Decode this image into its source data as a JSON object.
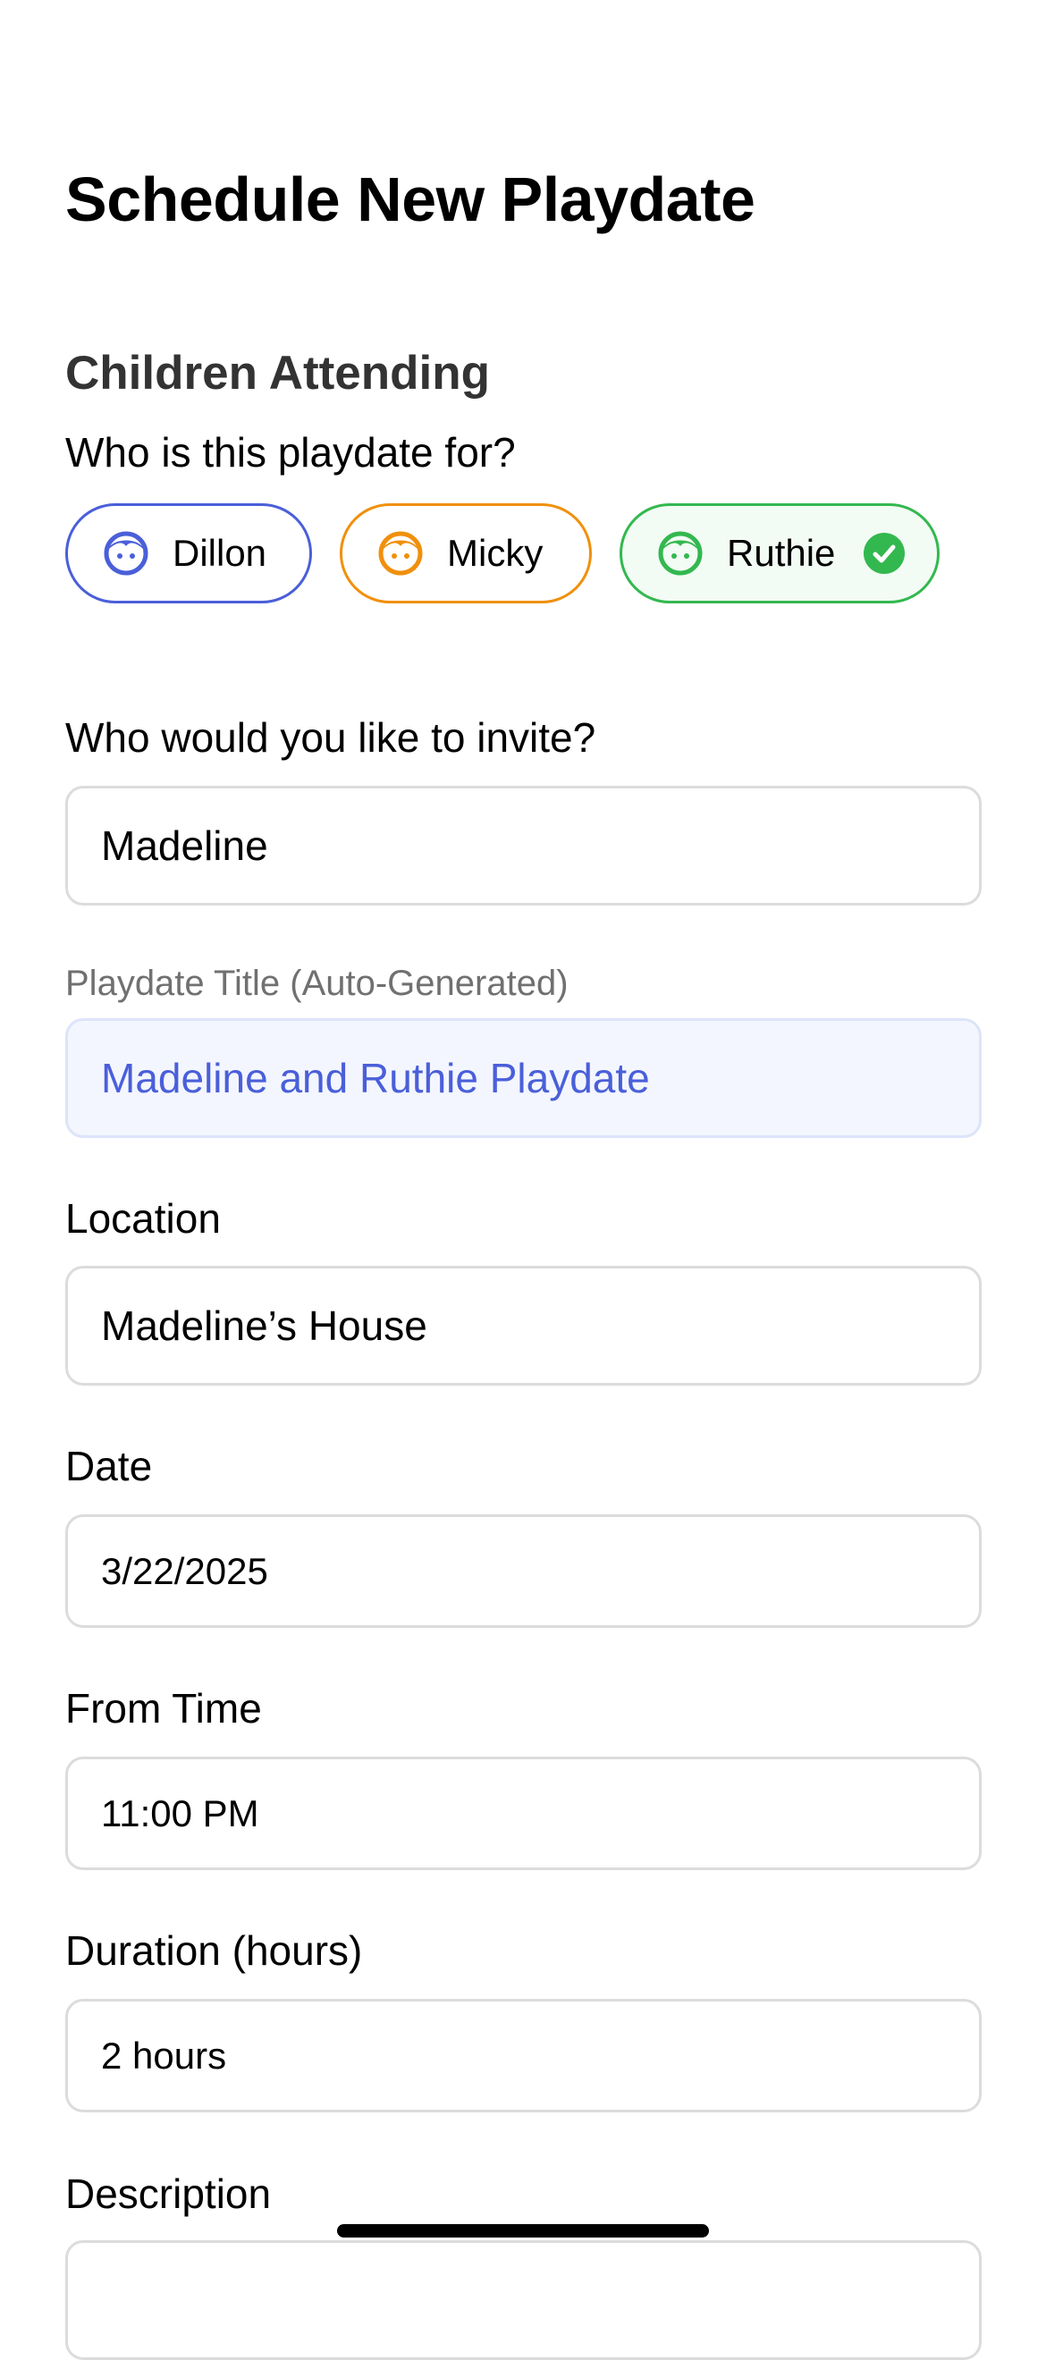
{
  "header": {
    "title": "Schedule New Playdate"
  },
  "children_section": {
    "heading": "Children Attending",
    "prompt": "Who is this playdate for?",
    "children": [
      {
        "name": "Dillon",
        "color": "#4a5fd9",
        "selected": false,
        "icon": "child-face-icon"
      },
      {
        "name": "Micky",
        "color": "#f0900c",
        "selected": false,
        "icon": "child-face-icon"
      },
      {
        "name": "Ruthie",
        "color": "#33b84f",
        "selected": true,
        "icon": "child-face-icon",
        "selected_icon": "checkmark-circle-icon"
      }
    ]
  },
  "invite": {
    "label": "Who would you like to invite?",
    "value": "Madeline"
  },
  "playdate_title": {
    "label": "Playdate Title (Auto-Generated)",
    "value": "Madeline and Ruthie Playdate"
  },
  "location": {
    "label": "Location",
    "value": "Madeline’s House"
  },
  "date": {
    "label": "Date",
    "value": "3/22/2025"
  },
  "from_time": {
    "label": "From Time",
    "value": "11:00 PM"
  },
  "duration": {
    "label": "Duration (hours)",
    "value": "2 hours"
  },
  "description": {
    "label": "Description"
  },
  "colors": {
    "accent_blue": "#4a5fd9",
    "accent_orange": "#f0900c",
    "accent_green": "#33b84f",
    "field_border": "#dcdcdc",
    "auto_field_bg": "#f3f6fe"
  }
}
